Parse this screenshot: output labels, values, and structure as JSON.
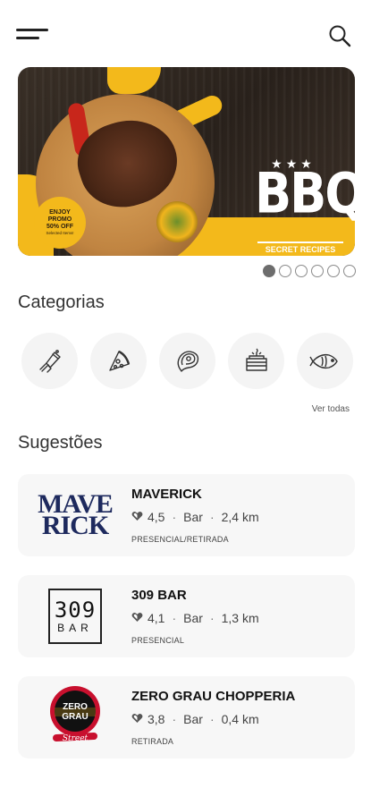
{
  "header": {
    "menu_icon": "hamburger-menu-icon",
    "search_icon": "search-icon"
  },
  "banner": {
    "title": "BBQ",
    "subtitle": "SECRET RECIPES",
    "promo_line1": "ENJOY",
    "promo_line2": "PROMO",
    "promo_line3": "50% OFF",
    "promo_small": "Selected Items!",
    "accent_color": "#f3b91b",
    "carousel_pages": 6,
    "carousel_active": 1
  },
  "categories": {
    "title": "Categorias",
    "see_all": "Ver todas",
    "items": [
      {
        "icon": "drink-icon"
      },
      {
        "icon": "pizza-icon"
      },
      {
        "icon": "steak-icon"
      },
      {
        "icon": "cake-icon"
      },
      {
        "icon": "fish-icon"
      }
    ]
  },
  "suggestions": {
    "title": "Sugestões",
    "items": [
      {
        "name": "MAVERICK",
        "rating": "4,5",
        "type": "Bar",
        "distance": "2,4 km",
        "mode": "PRESENCIAL/RETIRADA",
        "logo_line1": "MAVE",
        "logo_line2": "RICK"
      },
      {
        "name": "309 BAR",
        "rating": "4,1",
        "type": "Bar",
        "distance": "1,3 km",
        "mode": "PRESENCIAL",
        "logo_line1": "309",
        "logo_line2": "BAR"
      },
      {
        "name": "ZERO GRAU CHOPPERIA",
        "rating": "3,8",
        "type": "Bar",
        "distance": "0,4 km",
        "mode": "RETIRADA",
        "logo_line1": "ZERO",
        "logo_line2": "GRAU",
        "logo_line3": "Street"
      }
    ]
  }
}
